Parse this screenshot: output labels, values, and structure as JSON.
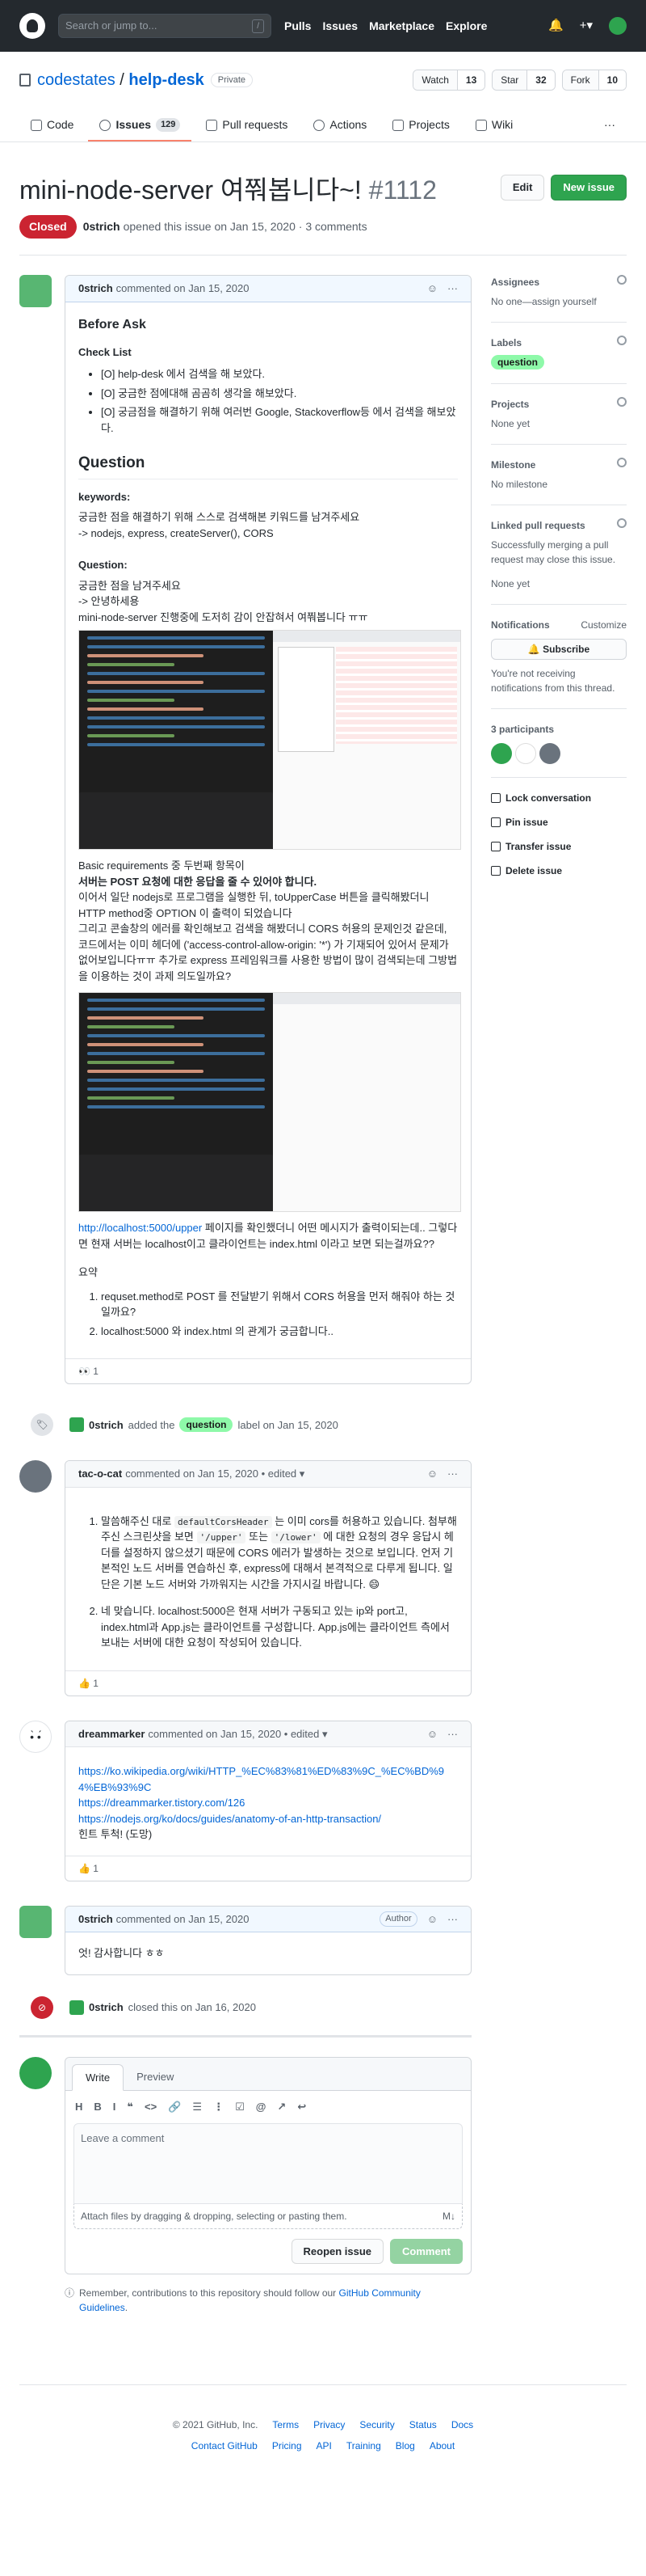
{
  "header": {
    "search_placeholder": "Search or jump to...",
    "slash": "/",
    "nav": [
      "Pulls",
      "Issues",
      "Marketplace",
      "Explore"
    ]
  },
  "repo": {
    "owner": "codestates",
    "name": "help-desk",
    "visibility": "Private",
    "watch": "Watch",
    "watch_count": "13",
    "star": "Star",
    "star_count": "32",
    "fork": "Fork",
    "fork_count": "10",
    "sep": "/"
  },
  "tabs": [
    {
      "label": "Code"
    },
    {
      "label": "Issues",
      "count": "129"
    },
    {
      "label": "Pull requests"
    },
    {
      "label": "Actions"
    },
    {
      "label": "Projects"
    },
    {
      "label": "Wiki"
    },
    {
      "label": "···"
    }
  ],
  "issue": {
    "title": "mini-node-server 여쭤봅니다~!",
    "number": "#1112",
    "edit": "Edit",
    "new_issue": "New issue",
    "state": "Closed",
    "author": "0strich",
    "meta": "opened this issue on Jan 15, 2020 · 3 comments"
  },
  "c1": {
    "author": "0strich",
    "date": "commented on Jan 15, 2020",
    "h_before": "Before Ask",
    "h_check": "Check List",
    "checks": [
      "[O] help-desk 에서 검색을 해 보았다.",
      "[O] 궁금한 점에대해 곰곰히 생각을 해보았다.",
      "[O] 궁금점을 해결하기 위해 여러번 Google, Stackoverflow등 에서 검색을 해보았다."
    ],
    "h_question": "Question",
    "h_keywords": "keywords:",
    "kw1": "궁금한 점을 해결하기 위해 스스로 검색해본 키워드를 남겨주세요",
    "kw2": "-> nodejs, express, createServer(), CORS",
    "h_q": "Question:",
    "q1": "궁금한 점을 남겨주세요",
    "q2": "-> 안녕하세용",
    "q3": "mini-node-server 진행중에 도저히 감이 안잡혀서 여쭤봅니다 ㅠㅠ",
    "p1a": "Basic requirements 중 두번째 항목이",
    "p1b": "서버는 POST 요청에 대한 응답을 줄 수 있어야 합니다.",
    "p2": "이어서 일단 nodejs로 프로그램을 실행한 뒤, toUpperCase 버튼을 클릭해봤더니 HTTP method중 OPTION 이 출력이 되었습니다",
    "p3": "그리고 콘솔창의 에러를 확인해보고 검색을 해봤더니 CORS 허용의 문제인것 같은데, 코드에서는 이미 헤더에 ('access-control-allow-origin: '*') 가 기재되어 있어서 문제가 없어보입니다ㅠㅠ 추가로 express 프레임워크를 사용한 방법이 많이 검색되는데 그방법을 이용하는 것이 과제 의도일까요?",
    "link": "http://localhost:5000/upper",
    "p4": "페이지를 확인했더니 어떤 메시지가 출력이되는데.. 그렇다면 현재 서버는 localhost이고 클라이언트는 index.html 이라고 보면 되는걸까요??",
    "summary": "요약",
    "sum": [
      "requset.method로 POST 를 전달받기 위해서 CORS 허용을 먼저 해줘야 하는 것일까요?",
      "localhost:5000 와 index.html 의 관계가 궁금합니다.."
    ],
    "reaction": "👀 1"
  },
  "ev_label": {
    "actor": "0strich",
    "pre": "added the",
    "label": "question",
    "post": "label on Jan 15, 2020"
  },
  "c2": {
    "author": "tac-o-cat",
    "date": "commented on Jan 15, 2020 • edited ▾",
    "i1a": "말씀해주신 대로",
    "i1code": "defaultCorsHeader",
    "i1b": "는 이미 cors를 허용하고 있습니다. 첨부해주신 스크린샷을 보면",
    "i1c": "'/upper'",
    "i1d": "또는",
    "i1e": "'/lower'",
    "i1f": "에 대한 요청의 경우 응답시 헤더를 설정하지 않으셨기 때문에 CORS 에러가 발생하는 것으로 보입니다. 언저 기본적인 노드 서버를 연습하신 후, express에 대해서 본격적으로 다루게 됩니다. 일단은 기본 노드 서버와 가까워지는 시간을 가지시길 바랍니다. 😄",
    "i2": "네 맞습니다. localhost:5000은 현재 서버가 구동되고 있는 ip와 port고, index.html과 App.js는 클라이언트를 구성합니다. App.js에는 클라이언트 측에서 보내는 서버에 대한 요청이 작성되어 있습니다.",
    "reaction": "👍 1"
  },
  "c3": {
    "author": "dreammarker",
    "date": "commented on Jan 15, 2020 • edited ▾",
    "l1": "https://ko.wikipedia.org/wiki/HTTP_%EC%83%81%ED%83%9C_%EC%BD%94%EB%93%9C",
    "l2": "https://dreammarker.tistory.com/126",
    "l3": "https://nodejs.org/ko/docs/guides/anatomy-of-an-http-transaction/",
    "hint": "힌트 투척! (도망)",
    "reaction": "👍 1"
  },
  "c4": {
    "author": "0strich",
    "date": "commented on Jan 15, 2020",
    "role": "Author",
    "body": "엇! 감사합니다 ㅎㅎ"
  },
  "ev_closed": {
    "actor": "0strich",
    "text": "closed this on Jan 16, 2020"
  },
  "composer": {
    "write": "Write",
    "preview": "Preview",
    "tools": [
      "H",
      "B",
      "I",
      "❝",
      "<>",
      "🔗",
      "☰",
      "⋮",
      "☑",
      "@",
      "↗",
      "↩"
    ],
    "placeholder": "Leave a comment",
    "attach": "Attach files by dragging & dropping, selecting or pasting them.",
    "md": "M↓",
    "reopen": "Reopen issue",
    "comment": "Comment",
    "tip_pre": "Remember, contributions to this repository should follow our",
    "tip_link": "GitHub Community Guidelines",
    "tip_end": "."
  },
  "sidebar": {
    "assignees": "Assignees",
    "assignees_v": "No one—assign yourself",
    "labels": "Labels",
    "label": "question",
    "projects": "Projects",
    "projects_v": "None yet",
    "milestone": "Milestone",
    "milestone_v": "No milestone",
    "linked": "Linked pull requests",
    "linked_v": "Successfully merging a pull request may close this issue.",
    "linked_v2": "None yet",
    "notif": "Notifications",
    "customize": "Customize",
    "subscribe": "Subscribe",
    "notif_v": "You're not receiving notifications from this thread.",
    "participants": "3 participants",
    "lock": "Lock conversation",
    "pin": "Pin issue",
    "transfer": "Transfer issue",
    "delete": "Delete issue"
  },
  "footer": {
    "copy": "© 2021 GitHub, Inc.",
    "row1": [
      "Terms",
      "Privacy",
      "Security",
      "Status",
      "Docs"
    ],
    "row2": [
      "Contact GitHub",
      "Pricing",
      "API",
      "Training",
      "Blog",
      "About"
    ]
  }
}
